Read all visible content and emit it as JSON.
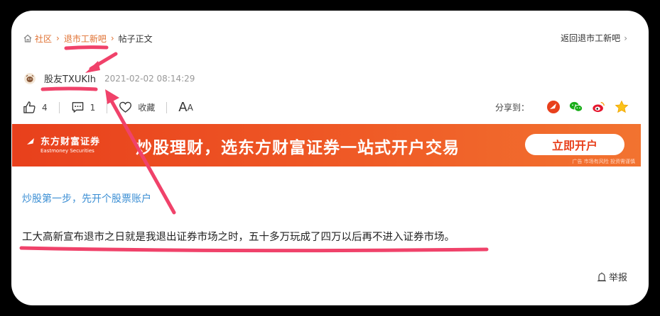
{
  "breadcrumb": {
    "home": "社区",
    "forum": "退市工新吧",
    "current": "帖子正文",
    "back": "返回退市工新吧"
  },
  "post": {
    "author": "股友TXUKIh",
    "time": "2021-02-02 08:14:29",
    "likes": "4",
    "comments": "1",
    "favorite": "收藏",
    "font_size_big": "A",
    "font_size_small": "A",
    "share_label": "分享到："
  },
  "banner": {
    "brand_cn": "东方财富证券",
    "brand_en": "Eastmoney Securities",
    "slogan": "炒股理财，选东方财富证券一站式开户交易",
    "button": "立即开户",
    "note": "广告 市场有风险 投资需谨慎"
  },
  "content": {
    "promo": "炒股第一步，先开个股票账户",
    "text": "工大高新宣布退市之日就是我退出证券市场之时，五十多万玩成了四万以后再不进入证券市场。"
  },
  "report": "举报",
  "colors": {
    "accent": "#e07030",
    "annotation": "#f0426a",
    "banner": "#e8401c",
    "link": "#3c8fd4"
  }
}
